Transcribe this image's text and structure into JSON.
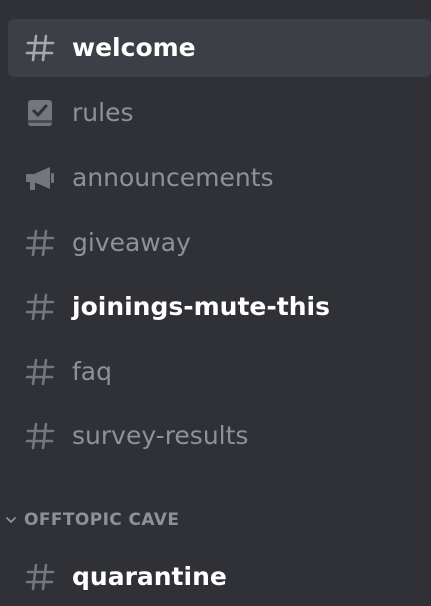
{
  "colors": {
    "background": "#2f3136",
    "selected_bg": "#3c3f45",
    "muted_text": "#8e9297",
    "active_text": "#ffffff",
    "icon_muted": "#72767d"
  },
  "channels": [
    {
      "name": "welcome",
      "icon": "hash-icon",
      "state": "selected"
    },
    {
      "name": "rules",
      "icon": "rules-icon",
      "state": "read"
    },
    {
      "name": "announcements",
      "icon": "megaphone-icon",
      "state": "read"
    },
    {
      "name": "giveaway",
      "icon": "hash-icon",
      "state": "read"
    },
    {
      "name": "joinings-mute-this",
      "icon": "hash-icon",
      "state": "unread"
    },
    {
      "name": "faq",
      "icon": "hash-icon",
      "state": "read"
    },
    {
      "name": "survey-results",
      "icon": "hash-icon",
      "state": "read"
    }
  ],
  "category": {
    "label": "OFFTOPIC CAVE",
    "icon": "chevron-down-icon",
    "channels": [
      {
        "name": "quarantine",
        "icon": "hash-icon",
        "state": "unread"
      }
    ]
  }
}
